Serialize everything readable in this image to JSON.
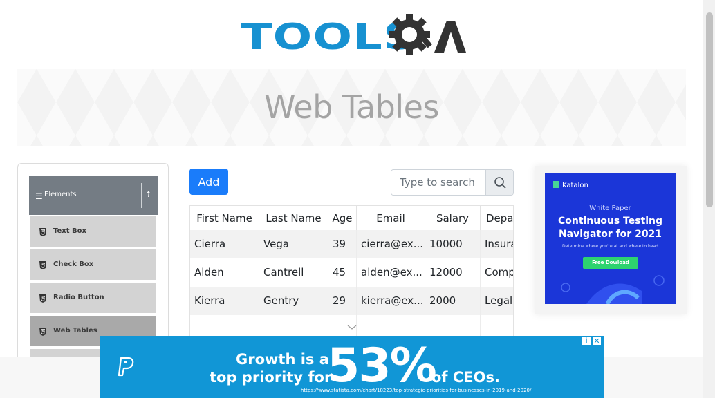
{
  "logo": {
    "word": "TOOLS",
    "suffix": "QA"
  },
  "banner": {
    "title": "Web Tables"
  },
  "sidebar": {
    "group_title": "Elements",
    "items": [
      {
        "label": "Text Box"
      },
      {
        "label": "Check Box"
      },
      {
        "label": "Radio Button"
      },
      {
        "label": "Web Tables",
        "active": true
      }
    ]
  },
  "toolbar": {
    "add_label": "Add"
  },
  "search": {
    "placeholder": "Type to search",
    "value": ""
  },
  "table": {
    "headers": [
      "First Name",
      "Last Name",
      "Age",
      "Email",
      "Salary",
      "Depar"
    ],
    "rows": [
      [
        "Cierra",
        "Vega",
        "39",
        "cierra@ex...",
        "10000",
        "Insura"
      ],
      [
        "Alden",
        "Cantrell",
        "45",
        "alden@ex...",
        "12000",
        "Comp"
      ],
      [
        "Kierra",
        "Gentry",
        "29",
        "kierra@ex...",
        "2000",
        "Legal"
      ]
    ]
  },
  "side_ad": {
    "brand": "Katalon",
    "eyebrow": "White Paper",
    "headline_1": "Continuous Testing",
    "headline_2": "Navigator for 2021",
    "subtitle": "Determine where you're at and where to head",
    "button": "Free Dowload"
  },
  "bottom_ad": {
    "line1": "Growth is a",
    "line2": "top priority for",
    "big": "53%",
    "tail": "of CEOs.",
    "source": "https://www.statista.com/chart/18223/top-strategic-priorities-for-businesses-in-2019-and-2020/",
    "close": "✕",
    "adchoices": "i"
  },
  "colors": {
    "brand_blue": "#1791d1",
    "add_button": "#1a7cfa",
    "ad_blue": "#1196d6",
    "sidebar_header": "#747c84"
  }
}
